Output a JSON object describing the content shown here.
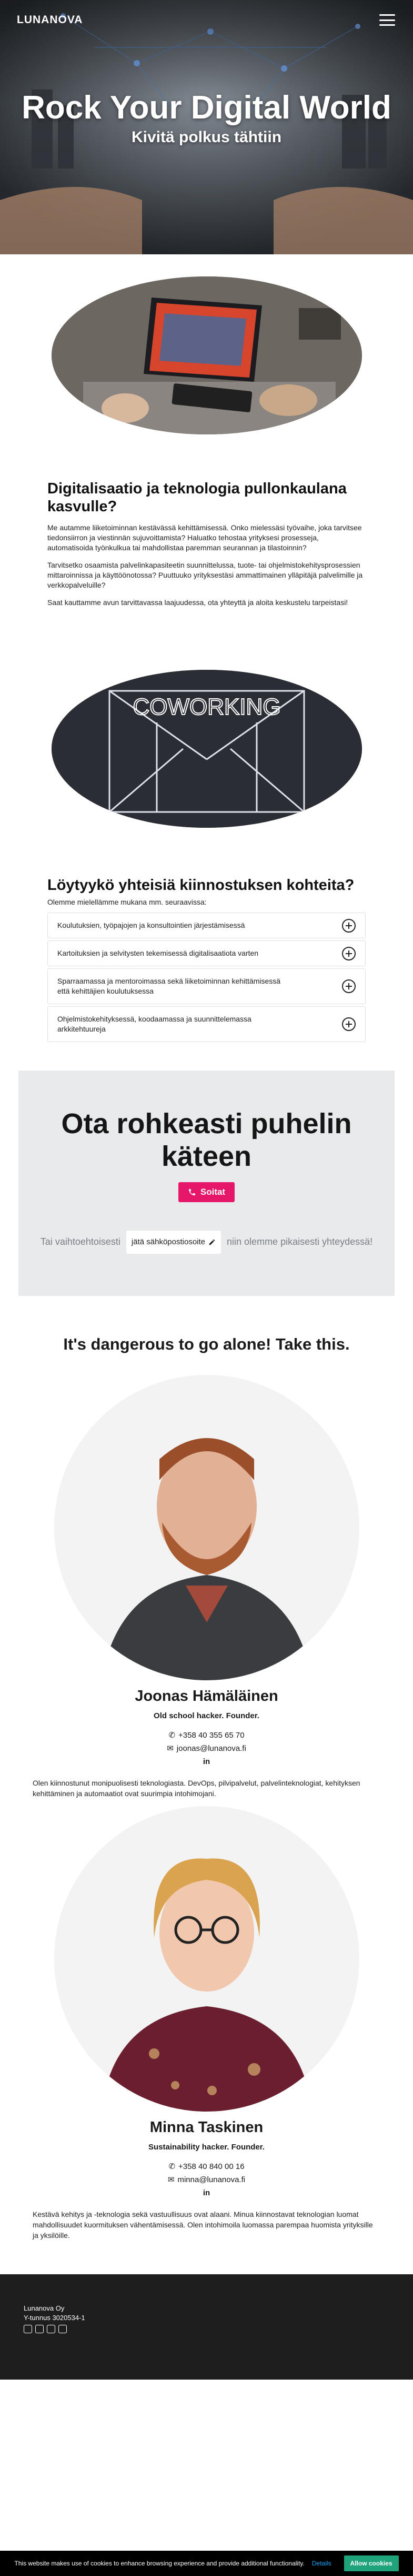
{
  "nav": {
    "brand": "LUNANOVA"
  },
  "hero": {
    "title": "Rock Your Digital World",
    "subtitle": "Kivitä polkus tähtiin"
  },
  "growth": {
    "title": "Digitalisaatio ja teknologia pullonkaulana kasvulle?",
    "p1": "Me autamme liiketoiminnan kestävässä kehittämisessä. Onko mielessäsi työvaihe, joka tarvitsee tiedonsiirron ja viestinnän sujuvoittamista? Haluatko tehostaa yrityksesi prosesseja, automatisoida työnkulkua tai mahdollistaa paremman seurannan ja tilastoinnin?",
    "p2": "Tarvitsetko osaamista palvelinkapasiteetin suunnittelussa, tuote- tai ohjelmistokehitysprosessien mittaroinnissa ja käyttöönotossa? Puuttuuko yrityksestäsi ammattimainen ylläpitäjä palvelimille ja verkkopalveluille?",
    "p3": "Saat kauttamme avun tarvittavassa laajuudessa, ota yhteyttä ja aloita keskustelu tarpeistasi!"
  },
  "coworking": {
    "sign": "COWORKING",
    "title": "Löytyykö yhteisiä kiinnostuksen kohteita?",
    "intro": "Olemme mielellämme mukana mm. seuraavissa:",
    "items": [
      "Koulutuksien, työpajojen ja konsultointien järjestämisessä",
      "Kartoituksien ja selvitysten tekemisessä digitalisaatiota varten",
      "Sparraamassa ja mentoroimassa sekä liiketoiminnan kehittämisessä että kehittäjien koulutuksessa",
      "Ohjelmistokehityksessä, koodaamassa ja suunnittelemassa arkkitehtuureja"
    ]
  },
  "call": {
    "title": "Ota rohkeasti puhelin käteen",
    "button": "Soitat",
    "alt_pre": "Tai vaihtoehtoisesti",
    "input_placeholder": "jätä sähköpostiosoite",
    "alt_post": "niin olemme pikaisesti yhteydessä!"
  },
  "team": {
    "title": "It's dangerous to go alone! Take this.",
    "members": [
      {
        "name": "Joonas Hämäläinen",
        "role": "Old school hacker. Founder.",
        "phone": "+358 40 355 65 70",
        "email": "joonas@lunanova.fi",
        "linkedin": "in",
        "bio": "Olen kiinnostunut monipuolisesti teknologiasta. DevOps, pilvipalvelut, palvelinteknologiat, kehityksen kehittäminen ja automaatiot ovat suurimpia intohimojani."
      },
      {
        "name": "Minna Taskinen",
        "role": "Sustainability hacker. Founder.",
        "phone": "+358 40 840 00 16",
        "email": "minna@lunanova.fi",
        "linkedin": "in",
        "bio": "Kestävä kehitys ja -teknologia sekä vastuullisuus ovat alaani. Minua kiinnostavat teknologian luomat mahdollisuudet kuormituksen vähentämisessä. Olen intohimoila luomassa parempaa huomista yrityksille ja yksilöille."
      }
    ]
  },
  "footer": {
    "company": "Lunanova Oy",
    "ytunnus": "Y-tunnus 3020534-1"
  },
  "cookie": {
    "text": "This website makes use of cookies to enhance browsing experience and provide additional functionality.",
    "details": "Details",
    "allow": "Allow cookies"
  },
  "colors": {
    "accent": "#e6176b",
    "cookie_allow": "#1fa37a",
    "callbox_bg": "#e8eaec"
  }
}
